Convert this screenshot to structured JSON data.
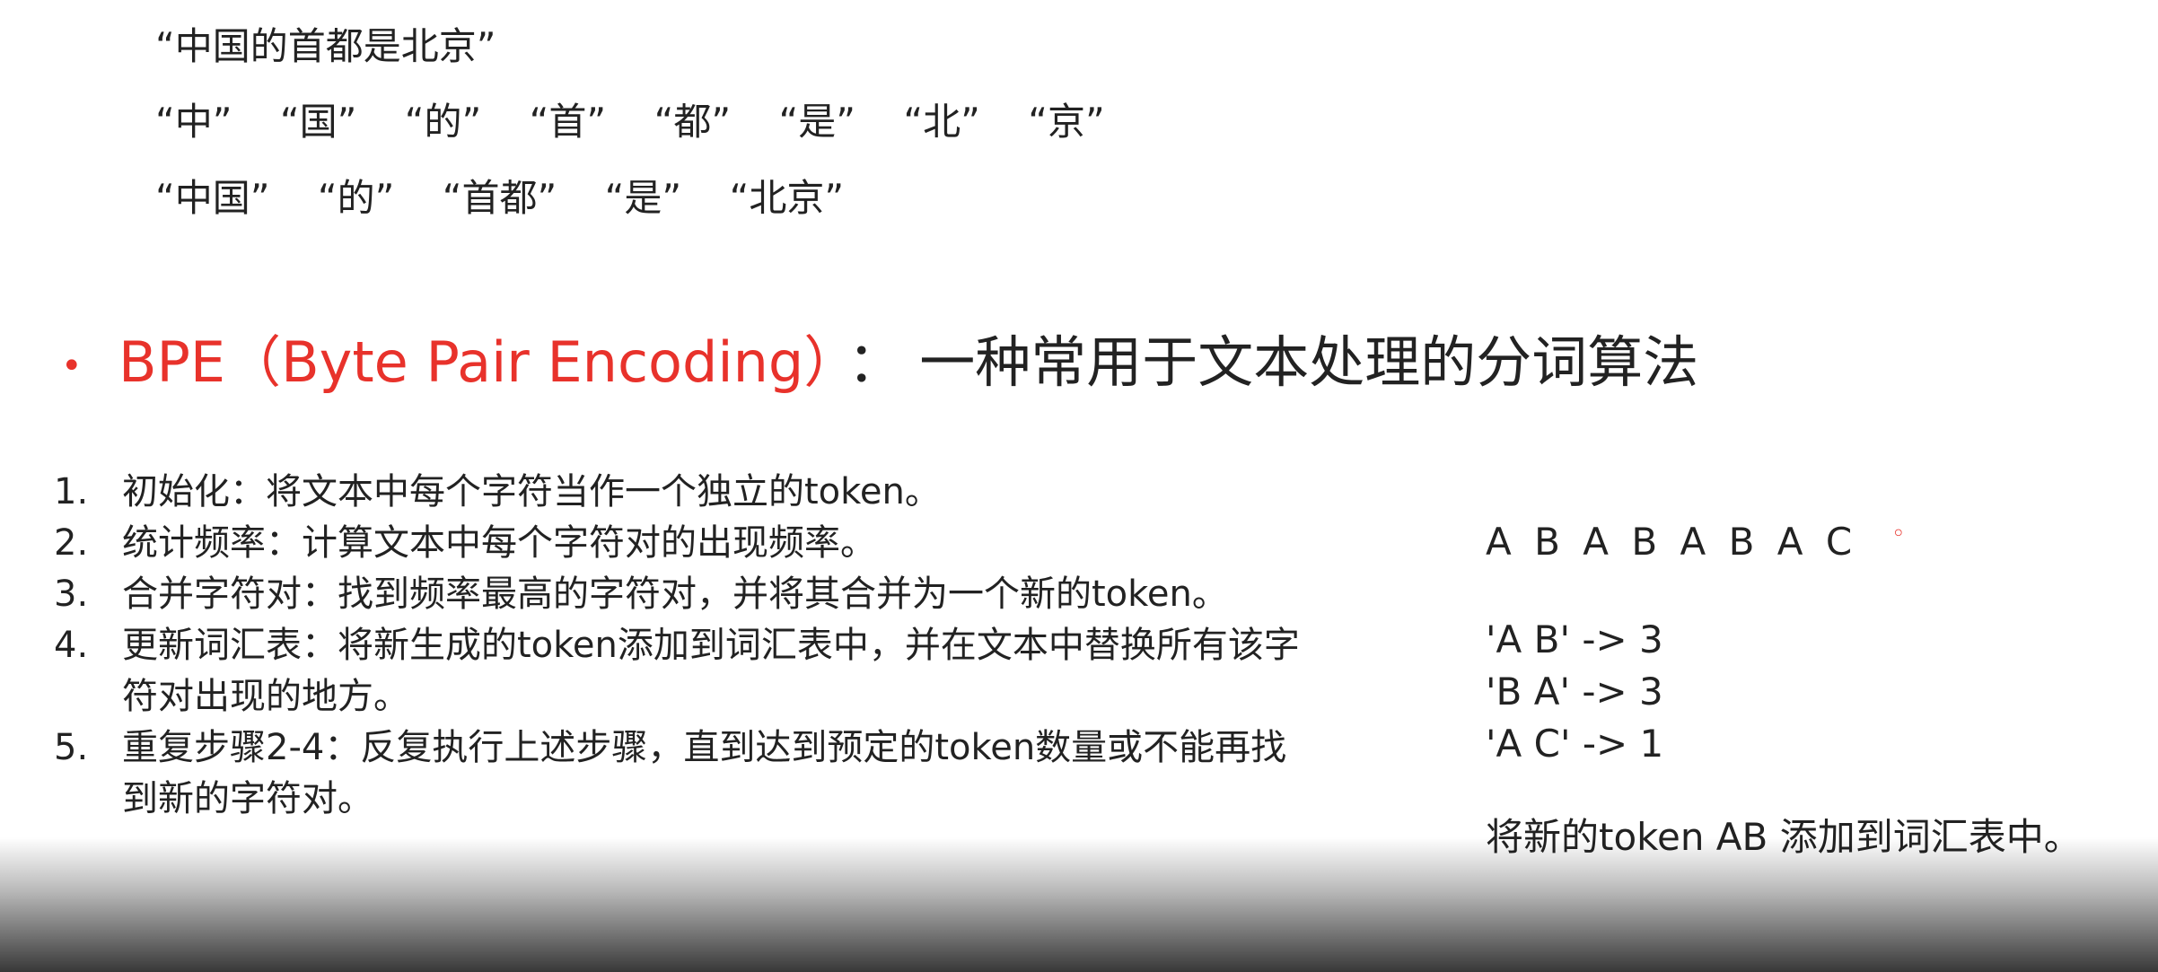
{
  "sentence": "“中国的首都是北京”",
  "char_tokens": [
    "“中”",
    "“国”",
    "“的”",
    "“首”",
    "“都”",
    "“是”",
    "“北”",
    "“京”"
  ],
  "word_tokens": [
    "“中国”",
    "“的”",
    "“首都”",
    "“是”",
    "“北京”"
  ],
  "heading": {
    "bullet": "•",
    "term": "BPE（Byte Pair Encoding）",
    "colon": "：",
    "description": "一种常用于文本处理的分词算法"
  },
  "steps": [
    {
      "num": "1.",
      "text": "初始化：将文本中每个字符当作一个独立的token。"
    },
    {
      "num": "2.",
      "text": "统计频率：计算文本中每个字符对的出现频率。"
    },
    {
      "num": "3.",
      "text": "合并字符对：找到频率最高的字符对，并将其合并为一个新的token。"
    },
    {
      "num": "4.",
      "text": "更新词汇表：将新生成的token添加到词汇表中，并在文本中替换所有该字符对出现的地方。"
    },
    {
      "num": "5.",
      "text": "重复步骤2-4：反复执行上述步骤，直到达到预定的token数量或不能再找到新的字符对。"
    }
  ],
  "example": {
    "sequence": "A B A B A B A C",
    "marker": "◦",
    "pairs": [
      "'A B' -> 3",
      "'B A' -> 3",
      "'A C' -> 1"
    ],
    "result": "将新的token AB 添加到词汇表中。"
  },
  "colors": {
    "accent": "#e8322b",
    "text": "#222222",
    "background": "#ffffff"
  }
}
